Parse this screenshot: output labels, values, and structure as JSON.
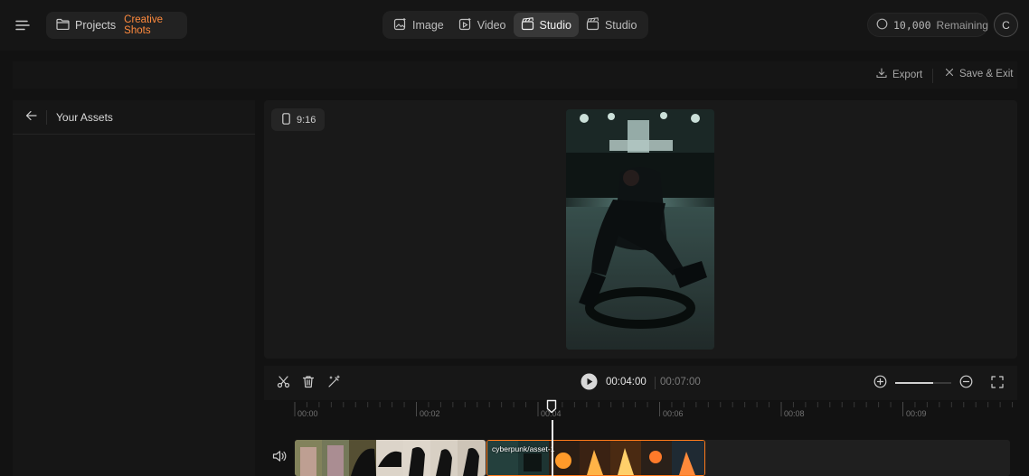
{
  "header": {
    "projects_label": "Projects",
    "project_name": "Creative Shots",
    "modes": [
      {
        "label": "Image",
        "icon": "image-sparkle-icon"
      },
      {
        "label": "Video",
        "icon": "video-sparkle-icon"
      },
      {
        "label": "Studio",
        "icon": "clapperboard-icon",
        "active": true
      },
      {
        "label": "Studio",
        "icon": "clapperboard-icon"
      }
    ],
    "credits_count": "10,000",
    "credits_label": "Remaining",
    "avatar_initial": "C"
  },
  "actions": {
    "export_label": "Export",
    "save_exit_label": "Save & Exit"
  },
  "assets_panel": {
    "title": "Your Assets"
  },
  "preview": {
    "aspect_ratio": "9:16"
  },
  "timeline": {
    "current_time": "00:04:00",
    "total_time": "00:07:00",
    "ruler_labels": [
      "00:00",
      "00:02",
      "00:04",
      "00:06",
      "00:08",
      "00:09"
    ],
    "zoom_level": 0.68,
    "clips": [
      {
        "label": ""
      },
      {
        "label": "cyberpunk/asset-1",
        "selected": true
      }
    ]
  },
  "colors": {
    "accent": "#ff8a3d",
    "selected_clip_border": "#ff7a1a",
    "background": "#121212",
    "panel": "#191919"
  }
}
